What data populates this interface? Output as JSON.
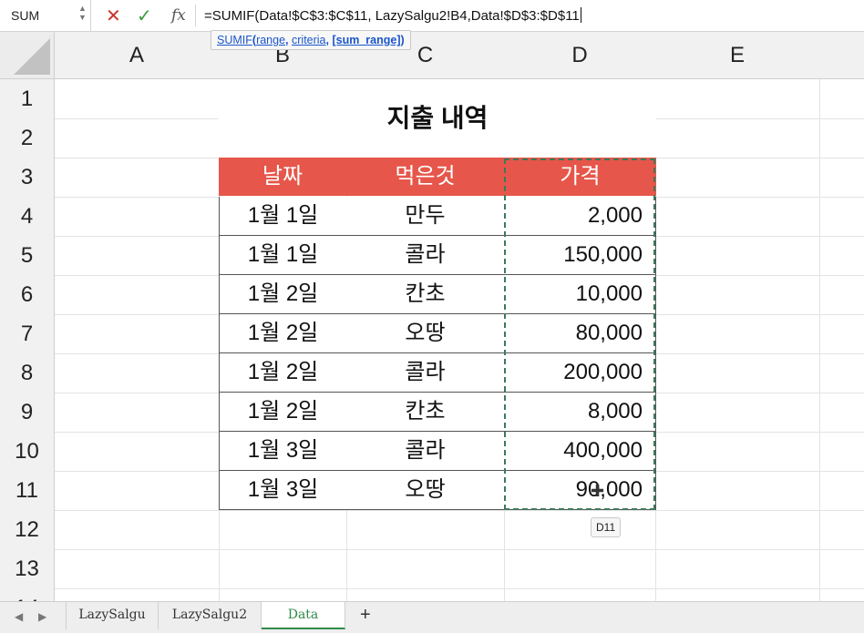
{
  "formula_bar": {
    "name_box": "SUM",
    "fx_label": "fx",
    "formula": "=SUMIF(Data!$C$3:$C$11, LazySalgu2!B4,Data!$D$3:$D$11",
    "tooltip": {
      "fn": "SUMIF",
      "open": "(",
      "arg1": "range",
      "sep1": ", ",
      "arg2": "criteria",
      "sep2": ", ",
      "arg3": "[sum_range]",
      "close": ")"
    }
  },
  "columns": [
    "A",
    "B",
    "C",
    "D",
    "E"
  ],
  "rows": [
    "1",
    "2",
    "3",
    "4",
    "5",
    "6",
    "7",
    "8",
    "9",
    "10",
    "11",
    "12",
    "13",
    "14"
  ],
  "sheet": {
    "title": "지출 내역",
    "headers": [
      "날짜",
      "먹은것",
      "가격"
    ],
    "rows": [
      {
        "date": "1월 1일",
        "item": "만두",
        "price": "2,000"
      },
      {
        "date": "1월 1일",
        "item": "콜라",
        "price": "150,000"
      },
      {
        "date": "1월 2일",
        "item": "칸초",
        "price": "10,000"
      },
      {
        "date": "1월 2일",
        "item": "오땅",
        "price": "80,000"
      },
      {
        "date": "1월 2일",
        "item": "콜라",
        "price": "200,000"
      },
      {
        "date": "1월 2일",
        "item": "칸초",
        "price": "8,000"
      },
      {
        "date": "1월 3일",
        "item": "콜라",
        "price": "400,000"
      },
      {
        "date": "1월 3일",
        "item": "오땅",
        "price": "90,000"
      }
    ],
    "header_color": "#e6564a"
  },
  "cell_tooltip": "D11",
  "tabs": [
    "LazySalgu",
    "LazySalgu2",
    "Data"
  ],
  "active_tab": "Data",
  "add_tab": "+"
}
